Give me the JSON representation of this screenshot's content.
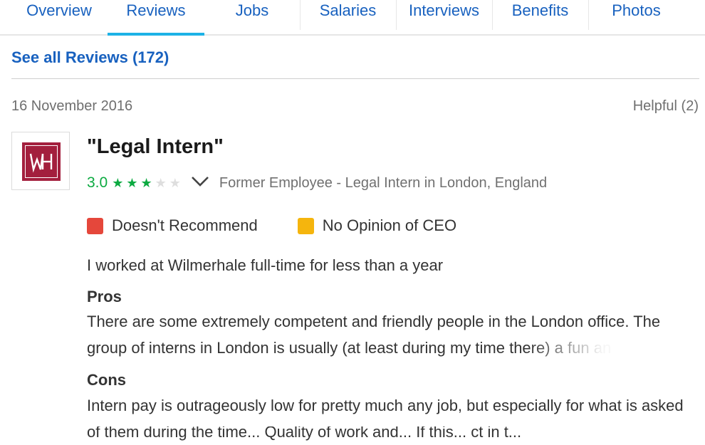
{
  "tabs": [
    {
      "label": "Overview"
    },
    {
      "label": "Reviews",
      "active": true
    },
    {
      "label": "Jobs"
    },
    {
      "label": "Salaries"
    },
    {
      "label": "Interviews"
    },
    {
      "label": "Benefits"
    },
    {
      "label": "Photos"
    }
  ],
  "see_all_link": "See all Reviews (172)",
  "review": {
    "date": "16 November 2016",
    "helpful": "Helpful (2)",
    "logo": {
      "text": "WH",
      "color": "#a31f3d"
    },
    "title": "\"Legal Intern\"",
    "rating": "3.0",
    "stars_filled": 3,
    "stars_total": 5,
    "author": "Former Employee - Legal Intern in London, England",
    "recommend": {
      "label": "Doesn't Recommend",
      "color": "#e5473b"
    },
    "ceo_opinion": {
      "label": "No Opinion of CEO",
      "color": "#f5b50d"
    },
    "employment": "I worked at Wilmerhale full-time for less than a year",
    "pros_heading": "Pros",
    "pros_text": "There are some extremely competent and friendly people in the London office. The group of interns in London is usually (at least during my time there) a fun an",
    "cons_heading": "Cons",
    "cons_text": "Intern pay is outrageously low for pretty much any job, but especially for what is asked of them during the time... Quality of work and... If this... ct in t..."
  },
  "colors": {
    "link": "#1861bf",
    "accent_tab": "#1db2e6",
    "rating_green": "#0caa41"
  }
}
